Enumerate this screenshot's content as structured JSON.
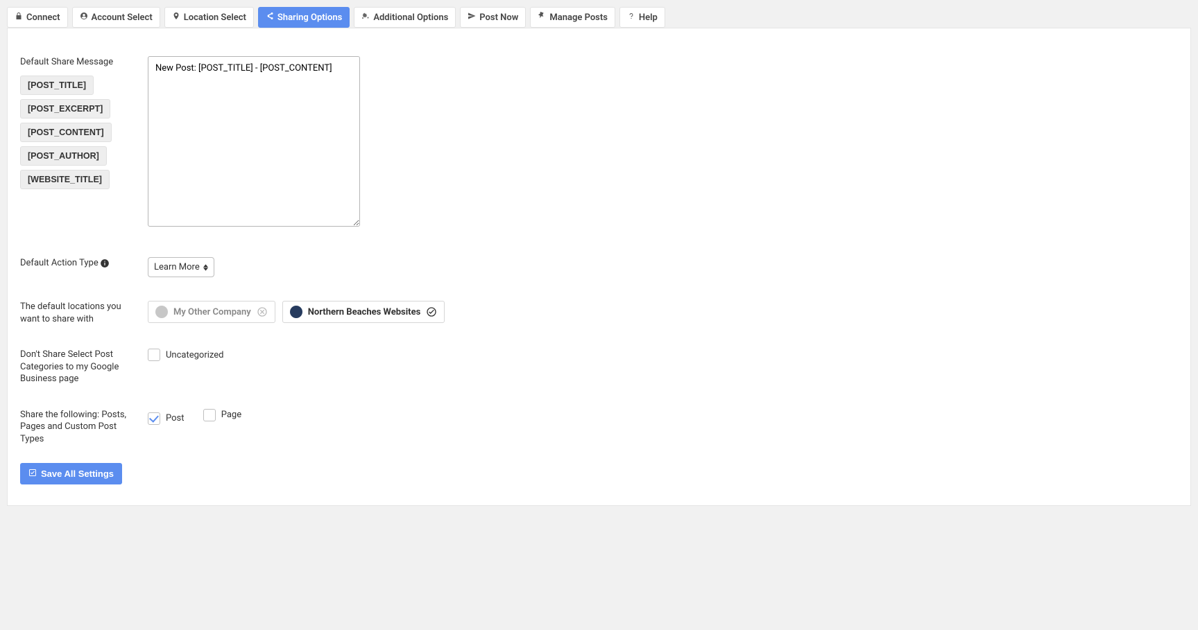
{
  "tabs": [
    {
      "id": "connect",
      "label": "Connect",
      "icon": "lock"
    },
    {
      "id": "account",
      "label": "Account Select",
      "icon": "user-circle"
    },
    {
      "id": "location",
      "label": "Location Select",
      "icon": "map-pin"
    },
    {
      "id": "sharing",
      "label": "Sharing Options",
      "icon": "share",
      "active": true
    },
    {
      "id": "additional",
      "label": "Additional Options",
      "icon": "cogs"
    },
    {
      "id": "postnow",
      "label": "Post Now",
      "icon": "paper-plane"
    },
    {
      "id": "manage",
      "label": "Manage Posts",
      "icon": "thumbtack"
    },
    {
      "id": "help",
      "label": "Help",
      "icon": "question"
    }
  ],
  "share_message": {
    "label": "Default Share Message",
    "tokens": [
      "[POST_TITLE]",
      "[POST_EXCERPT]",
      "[POST_CONTENT]",
      "[POST_AUTHOR]",
      "[WEBSITE_TITLE]"
    ],
    "value": "New Post: [POST_TITLE] - [POST_CONTENT]"
  },
  "action_type": {
    "label": "Default Action Type",
    "selected": "Learn More"
  },
  "locations": {
    "label": "The default locations you want to share with",
    "items": [
      {
        "name": "My Other Company",
        "selected": false,
        "avatar_color": "#c7c7c7"
      },
      {
        "name": "Northern Beaches Websites",
        "selected": true,
        "avatar_color": "#263b5e"
      }
    ]
  },
  "categories_block": {
    "label": "Don't Share Select Post Categories to my Google Business page",
    "items": [
      {
        "name": "Uncategorized",
        "checked": false
      }
    ]
  },
  "share_types": {
    "label": "Share the following: Posts, Pages and Custom Post Types",
    "items": [
      {
        "name": "Post",
        "checked": true
      },
      {
        "name": "Page",
        "checked": false
      }
    ]
  },
  "save_button": "Save All Settings"
}
